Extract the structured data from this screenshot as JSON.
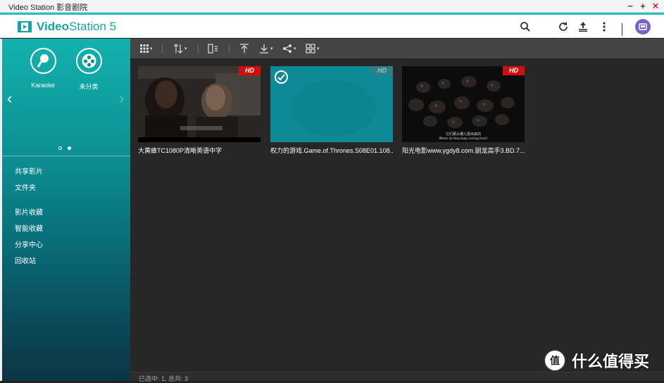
{
  "window": {
    "title": "Video Station 影音剧院",
    "min": "−",
    "max": "+",
    "close": "✕"
  },
  "app": {
    "name_bold": "Video",
    "name_rest": "Station 5"
  },
  "categories": [
    {
      "label": "Karaoke",
      "icon": "microphone-icon"
    },
    {
      "label": "未分类",
      "icon": "film-reel-icon"
    }
  ],
  "nav": {
    "group1": [
      "共享影片",
      "文件夹"
    ],
    "group2": [
      "影片收藏",
      "智能收藏",
      "分享中心",
      "回收站"
    ]
  },
  "toolbar": {
    "caret": "▾"
  },
  "videos": [
    {
      "title": "大黄蜂TC1080P清晰英语中字",
      "badge": "HD",
      "selected": false
    },
    {
      "title": "权力的游戏.Game.of.Thrones.S08E01.108...",
      "badge": "HD",
      "selected": true
    },
    {
      "title": "阳光电影www.ygdy8.com.驯龙高手3.BD.7...",
      "badge": "HD",
      "selected": false,
      "subtitle_line1": "它们那从哪儿冒出来的",
      "subtitle_line2": "Where do they keep coming from?"
    }
  ],
  "status": {
    "text": "已选中: 1, 总共: 3"
  },
  "watermark": {
    "badge": "值",
    "text": "什么值得买"
  },
  "colors": {
    "accent": "#1ec3bd",
    "hd_badge": "#d10f0f",
    "selected_tile": "#0e8a96",
    "avatar": "#7a63c7"
  }
}
